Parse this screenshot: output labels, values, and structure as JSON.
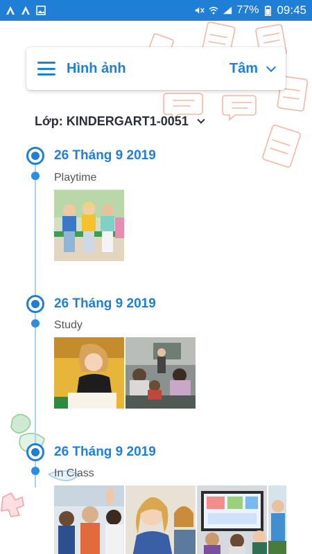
{
  "status_bar": {
    "battery": "77%",
    "time": "09:45"
  },
  "header": {
    "title": "Hình ảnh",
    "user": "Tâm"
  },
  "class_selector": {
    "label": "Lớp: KINDERGART1-0051"
  },
  "entries": [
    {
      "date": "26 Tháng 9 2019",
      "caption": "Playtime",
      "photo_count": 1
    },
    {
      "date": "26 Tháng 9 2019",
      "caption": "Study",
      "photo_count": 2
    },
    {
      "date": "26 Tháng 9 2019",
      "caption": "In Class",
      "photo_count": 4
    }
  ],
  "colors": {
    "accent": "#1f7fd6",
    "status_bar": "#1f7fd6",
    "timeline_line": "#a9d2f4",
    "doodle": "#f2b7a6"
  }
}
